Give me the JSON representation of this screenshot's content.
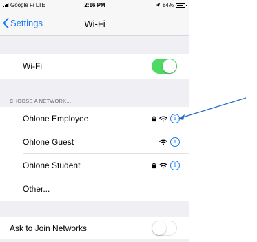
{
  "status_bar": {
    "carrier": "Google Fi LTE",
    "time": "2:16 PM",
    "battery": "84%",
    "battery_level": 0.84
  },
  "nav": {
    "back_label": "Settings",
    "title": "Wi-Fi"
  },
  "wifi_toggle": {
    "label": "Wi-Fi",
    "on": true
  },
  "section_header": "CHOOSE A NETWORK...",
  "networks": [
    {
      "name": "Ohlone Employee",
      "locked": true
    },
    {
      "name": "Ohlone Guest",
      "locked": false
    },
    {
      "name": "Ohlone Student",
      "locked": true
    }
  ],
  "other_label": "Other...",
  "ask_to_join": {
    "label": "Ask to Join Networks",
    "on": false
  },
  "info_glyph": "i",
  "colors": {
    "accent": "#1a7bf5",
    "toggle_on": "#4cd964",
    "annotation_arrow": "#1f6fc9"
  },
  "icons": [
    "chevron-left-icon",
    "location-arrow-icon",
    "battery-icon",
    "lock-icon",
    "wifi-icon",
    "info-icon",
    "annotation-arrow"
  ]
}
